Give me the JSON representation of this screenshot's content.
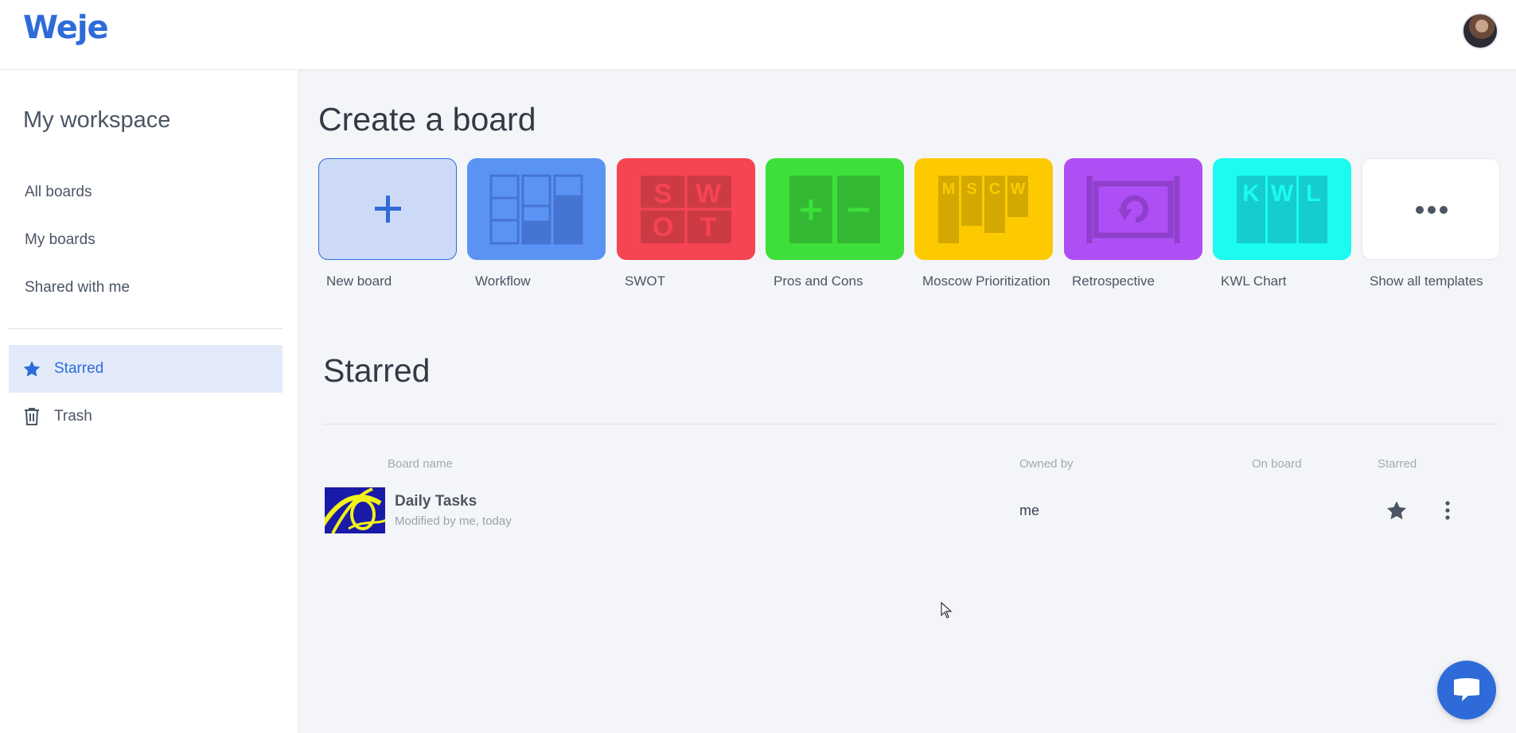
{
  "header": {
    "logo": "Weje",
    "avatar_icon": "user-avatar"
  },
  "sidebar": {
    "workspace_title": "My workspace",
    "nav": [
      {
        "label": "All boards"
      },
      {
        "label": "My boards"
      },
      {
        "label": "Shared with me"
      }
    ],
    "starred": {
      "label": "Starred",
      "icon": "star-icon",
      "active": true
    },
    "trash": {
      "label": "Trash",
      "icon": "trash-icon"
    }
  },
  "create": {
    "heading": "Create a board",
    "templates": [
      {
        "label": "New board",
        "color": "#ccdaf7",
        "icon": "plus-icon"
      },
      {
        "label": "Workflow",
        "color": "#5b93f5",
        "icon": "workflow-icon"
      },
      {
        "label": "SWOT",
        "color": "#f74452",
        "icon": "swot-icon",
        "letters": [
          "S",
          "W",
          "O",
          "T"
        ]
      },
      {
        "label": "Pros and Cons",
        "color": "#3de03a",
        "icon": "pros-cons-icon",
        "letters": [
          "+",
          "−"
        ]
      },
      {
        "label": "Moscow Prioritization",
        "color": "#fdca00",
        "icon": "moscow-icon",
        "letters": [
          "M",
          "S",
          "C",
          "W"
        ]
      },
      {
        "label": "Retrospective",
        "color": "#ae4ff5",
        "icon": "retrospective-icon"
      },
      {
        "label": "KWL Chart",
        "color": "#1bfbf0",
        "icon": "kwl-icon",
        "letters": [
          "K",
          "W",
          "L"
        ]
      },
      {
        "label": "Show all templates",
        "color": "#ffffff",
        "icon": "more-horizontal-icon"
      }
    ]
  },
  "starred": {
    "heading": "Starred",
    "columns": {
      "name": "Board name",
      "owner": "Owned by",
      "on_board": "On board",
      "starred": "Starred"
    },
    "rows": [
      {
        "title": "Daily Tasks",
        "subtitle": "Modified by me, today",
        "owner": "me",
        "on_board": "",
        "starred": true
      }
    ]
  },
  "chat": {
    "icon": "chat-icon"
  },
  "colors": {
    "accent": "#2f6bd8",
    "active_bg": "#e3ebfa"
  }
}
